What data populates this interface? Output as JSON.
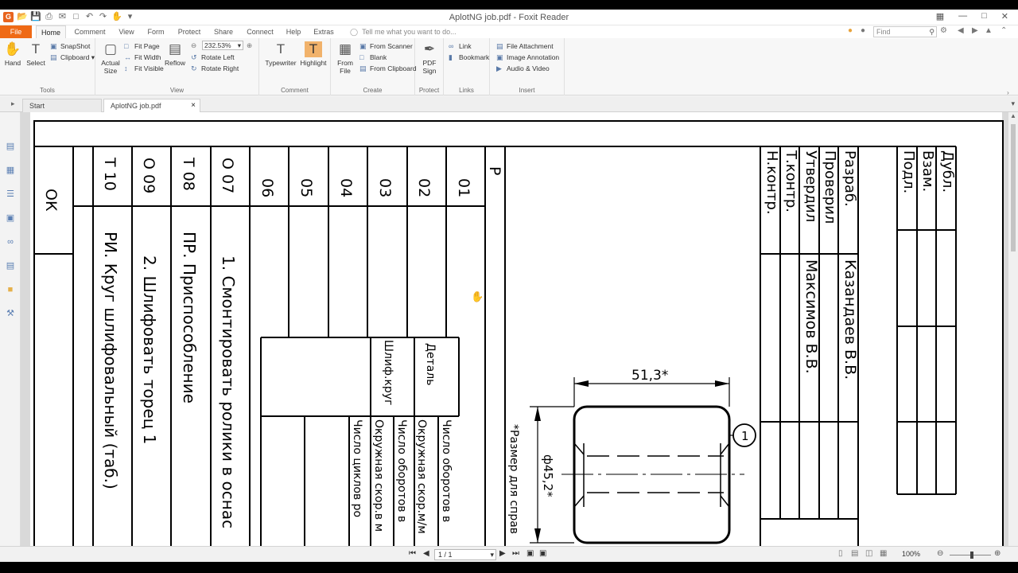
{
  "app": {
    "window_title": "AplotNG job.pdf - Foxit Reader",
    "tell_me": "Tell me what you want to do...",
    "find_placeholder": "Find"
  },
  "menu": [
    "File",
    "Home",
    "Comment",
    "View",
    "Form",
    "Protect",
    "Share",
    "Connect",
    "Help",
    "Extras"
  ],
  "ribbon": {
    "tools": {
      "label": "Tools",
      "hand": "Hand",
      "select": "Select",
      "snapshot": "SnapShot",
      "clipboard": "Clipboard"
    },
    "view": {
      "label": "View",
      "actual_size": "Actual Size",
      "fit_page": "Fit Page",
      "fit_width": "Fit Width",
      "fit_visible": "Fit Visible",
      "reflow": "Reflow",
      "zoom": "232.53%",
      "rotate_left": "Rotate Left",
      "rotate_right": "Rotate Right"
    },
    "comment": {
      "label": "Comment",
      "typewriter": "Typewriter",
      "highlight": "Highlight"
    },
    "create": {
      "label": "Create",
      "from_file": "From File",
      "from_scanner": "From Scanner",
      "blank": "Blank",
      "from_clipboard": "From Clipboard"
    },
    "protect": {
      "label": "Protect",
      "pdf_sign": "PDF Sign"
    },
    "links": {
      "label": "Links",
      "link": "Link",
      "bookmark": "Bookmark"
    },
    "insert": {
      "label": "Insert",
      "file_attachment": "File Attachment",
      "image_annotation": "Image Annotation",
      "audio_video": "Audio & Video"
    }
  },
  "doc_tabs": [
    {
      "label": "Start"
    },
    {
      "label": "AplotNG job.pdf",
      "close": "×"
    }
  ],
  "status": {
    "page": "1 / 1",
    "zoom": "100%"
  },
  "drawing": {
    "row_codes": [
      "ОК",
      "Т 10",
      "О 09",
      "Т 08",
      "О 07",
      "06",
      "05",
      "04",
      "03",
      "02",
      "01",
      "Р"
    ],
    "ops": [
      "РИ. Круг шлифовальный (таб.)",
      "2. Шлифовать торец 1",
      "ПР. Приспособление",
      "1. Смонтировать ролики в оснас"
    ],
    "table_headers": [
      "Деталь",
      "Шлиф.круг"
    ],
    "table_params": [
      "Число оборотов в",
      "Окружная скор.м/м",
      "Число оборотов в",
      "Окружная скор.в м",
      "Число циклов ро"
    ],
    "note": "*Размер для справ",
    "dim_length": "51,3*",
    "dim_diameter": "ф45,2*",
    "callout": "1",
    "roles": [
      "Разраб.",
      "Проверил",
      "Утвердил",
      "Т.контр.",
      "Н.контр."
    ],
    "names": [
      "Казандаев В.В.",
      "Максимов В.В."
    ],
    "side_labels": [
      "Дубл.",
      "Взам.",
      "Подл."
    ]
  }
}
